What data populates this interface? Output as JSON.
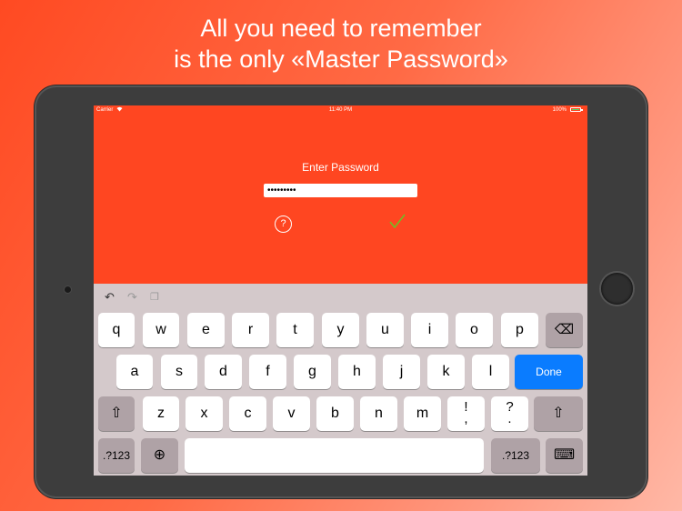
{
  "headline": {
    "line1": "All you need to remember",
    "line2": "is the only «Master Password»"
  },
  "statusbar": {
    "carrier": "Carrier",
    "wifi_icon": "wifi-icon",
    "time": "11:40 PM",
    "battery": "100%"
  },
  "app": {
    "prompt": "Enter Password",
    "password_value": "•••••••••",
    "help_label": "?",
    "check_color": "#6fbf24",
    "background_color": "#ff4621"
  },
  "keyboard": {
    "toolbar": {
      "undo": "↶",
      "redo": "↷",
      "paste": "❐"
    },
    "row1": [
      "q",
      "w",
      "e",
      "r",
      "t",
      "y",
      "u",
      "i",
      "o",
      "p"
    ],
    "row2": [
      "a",
      "s",
      "d",
      "f",
      "g",
      "h",
      "j",
      "k",
      "l"
    ],
    "row3": [
      "z",
      "x",
      "c",
      "v",
      "b",
      "n",
      "m"
    ],
    "row3_punct1": {
      "top": "!",
      "bottom": ","
    },
    "row3_punct2": {
      "top": "?",
      "bottom": "."
    },
    "numbers_label": ".?123",
    "done_label": "Done",
    "shift_glyph": "⇧",
    "globe_glyph": "⊕",
    "delete_glyph": "⌫",
    "dismiss_glyph": "⌨"
  }
}
